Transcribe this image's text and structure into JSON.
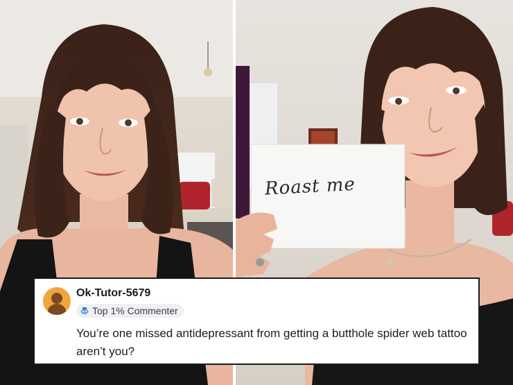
{
  "photo_left": {
    "subject": "woman-selfie"
  },
  "photo_right": {
    "subject": "woman-holding-sign",
    "sign_text": "Roast me"
  },
  "comment": {
    "username": "Ok-Tutor-5679",
    "flair": "Top 1% Commenter",
    "text": "You’re one missed antidepressant from getting a butthole spider web tattoo aren’t you?"
  },
  "colors": {
    "avatar": "#f0a63c",
    "border": "#1b1b1b",
    "flair_bg": "#eef0f2"
  },
  "icons": [
    "snoo-avatar-icon",
    "commenter-badge-icon"
  ]
}
